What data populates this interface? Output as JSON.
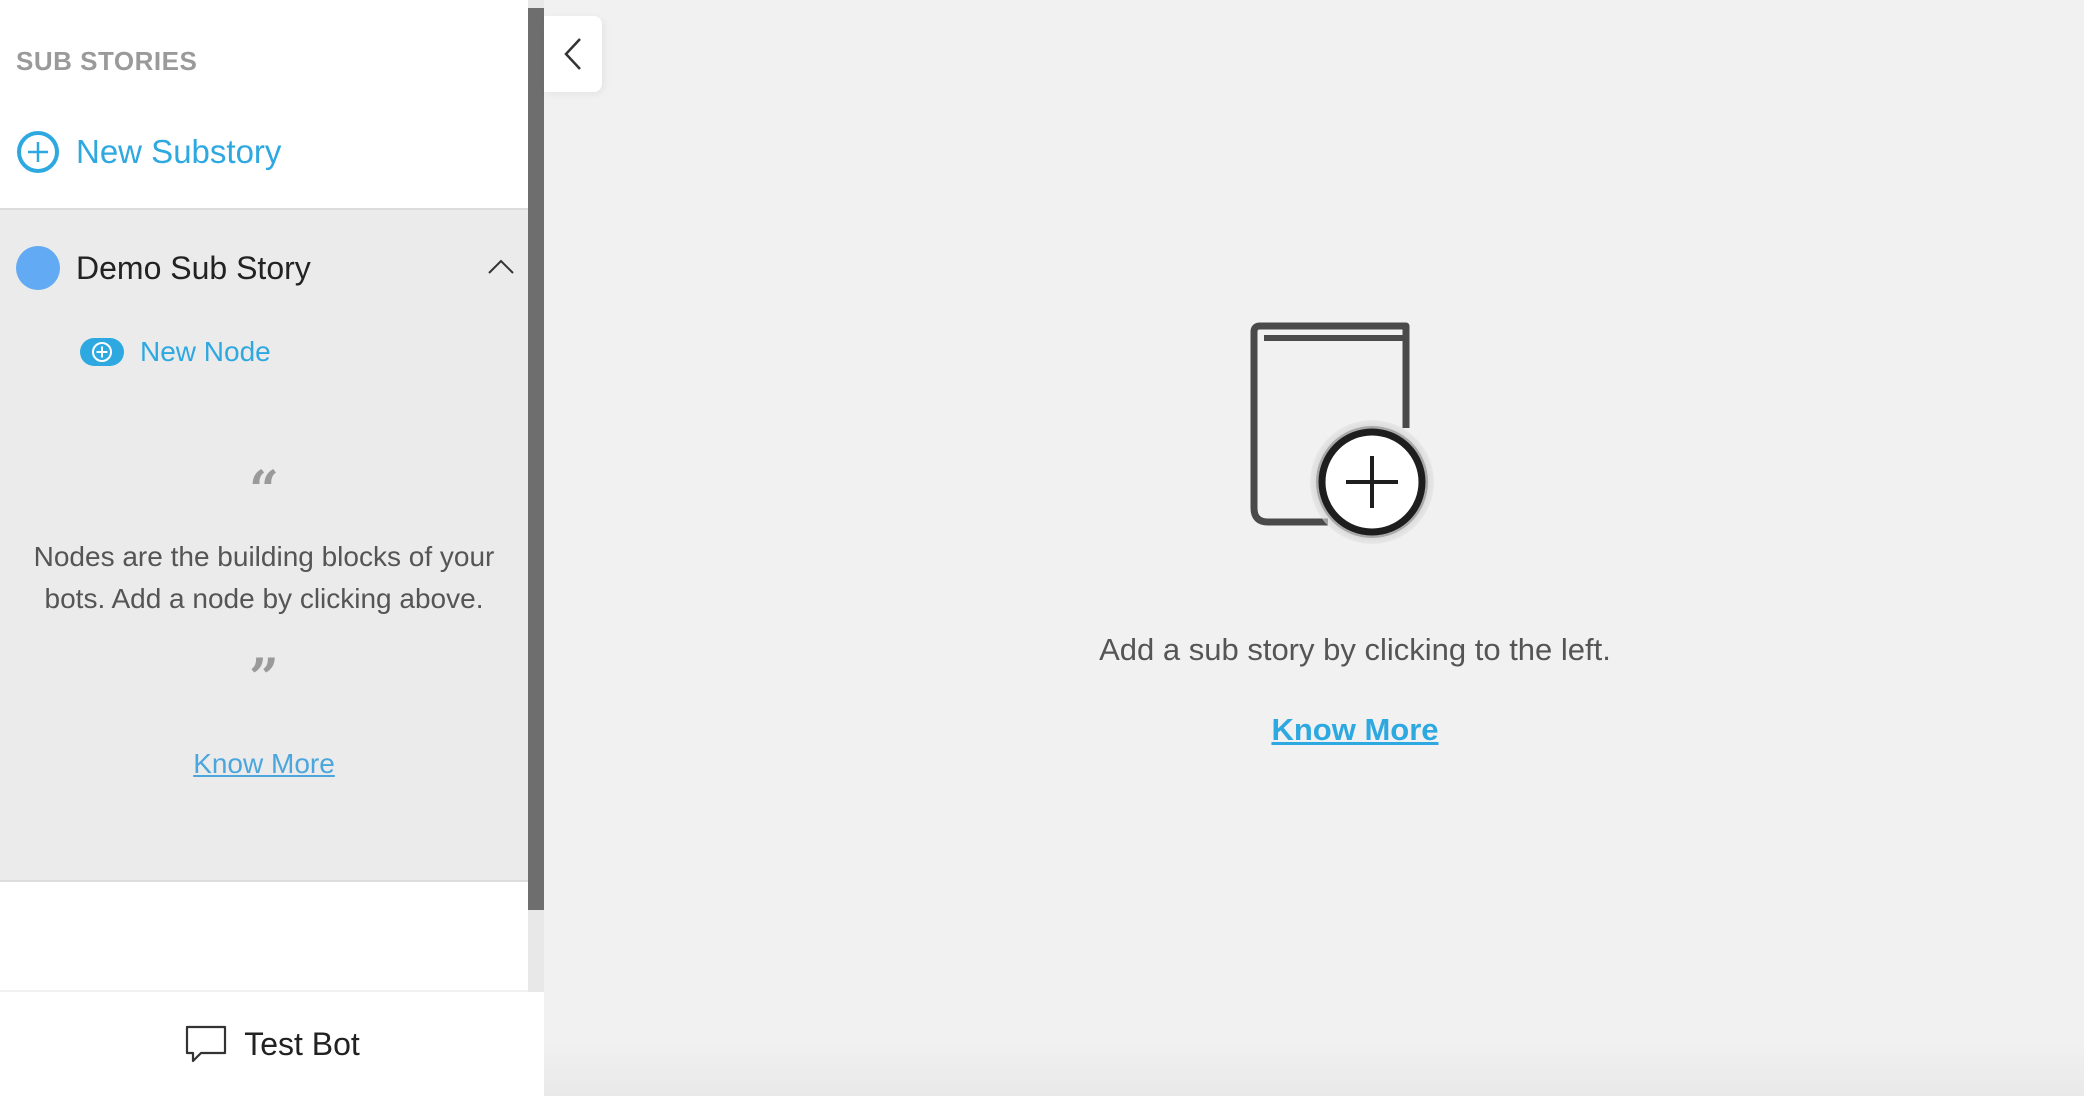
{
  "sidebar": {
    "title": "SUB STORIES",
    "new_substory_label": "New Substory",
    "substory": {
      "name": "Demo Sub Story",
      "dot_color": "#62abf4",
      "new_node_label": "New Node",
      "quote_open": "“",
      "quote_close": "”",
      "hint": "Nodes are the building blocks of your bots. Add a node by clicking above.",
      "know_more": "Know More"
    },
    "test_bot_label": "Test Bot"
  },
  "main": {
    "empty_message": "Add a sub story by clicking to the left.",
    "know_more": "Know More"
  },
  "colors": {
    "accent": "#2ea8e0",
    "scrollbar_thumb": "#6e6e6e"
  },
  "icons": {
    "new_substory": "plus-circle-icon",
    "collapse": "chevron-left-icon",
    "expand_state": "chevron-up-icon",
    "new_node": "plus-pill-icon",
    "test_bot": "chat-bubble-icon",
    "empty_state": "book-plus-icon"
  }
}
